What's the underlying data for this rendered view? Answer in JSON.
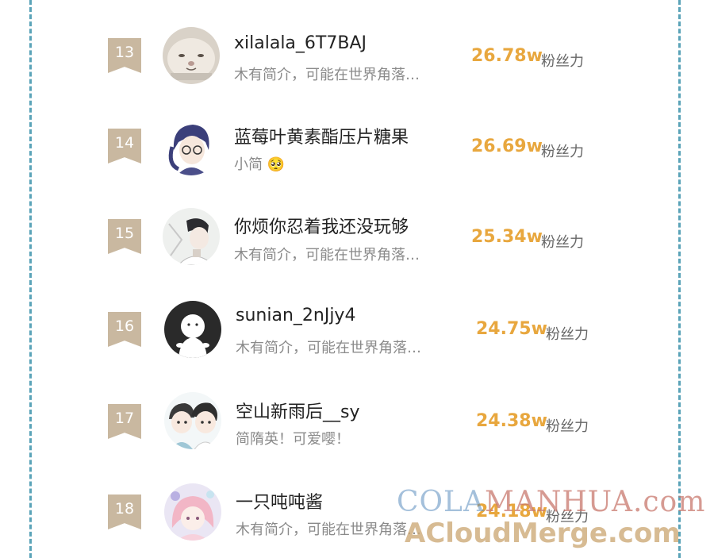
{
  "users": [
    {
      "rank": "13",
      "name": "xilalala_6T7BAJ",
      "bio": "木有简介，可能在世界角落…",
      "fans_value": "26.78w",
      "fans_label": "粉丝力",
      "avatar": "cat-avatar"
    },
    {
      "rank": "14",
      "name": "蓝莓叶黄素酯压片糖果",
      "bio": "小简",
      "bio_emoji": "🥺",
      "fans_value": "26.69w",
      "fans_label": "粉丝力",
      "avatar": "anime-boy-glasses-avatar"
    },
    {
      "rank": "15",
      "name": "你烦你忍着我还没玩够",
      "bio": "木有简介，可能在世界角落…",
      "fans_value": "25.34w",
      "fans_label": "粉丝力",
      "avatar": "anime-boy-avatar"
    },
    {
      "rank": "16",
      "name": "sunian_2nJjy4",
      "bio": "木有简介，可能在世界角落…",
      "fans_value": "24.75w",
      "fans_label": "粉丝力",
      "avatar": "default-user-avatar"
    },
    {
      "rank": "17",
      "name": "空山新雨后__sy",
      "bio": "简隋英！可爱嘤！",
      "fans_value": "24.38w",
      "fans_label": "粉丝力",
      "avatar": "chibi-couple-avatar"
    },
    {
      "rank": "18",
      "name": "一只吨吨酱",
      "bio": "木有简介，可能在世界角落…",
      "fans_value": "24.18w",
      "fans_label": "粉丝力",
      "avatar": "pink-hair-girl-avatar"
    }
  ],
  "watermark": {
    "line1_a": "COLA",
    "line1_b": "MANHUA.com",
    "line2": "ACloudMerge.com"
  },
  "colors": {
    "border": "#5aa3b8",
    "badge": "#c9b8a0",
    "fans_value": "#e8a73e",
    "name": "#222222",
    "bio": "#8a8a8a"
  }
}
